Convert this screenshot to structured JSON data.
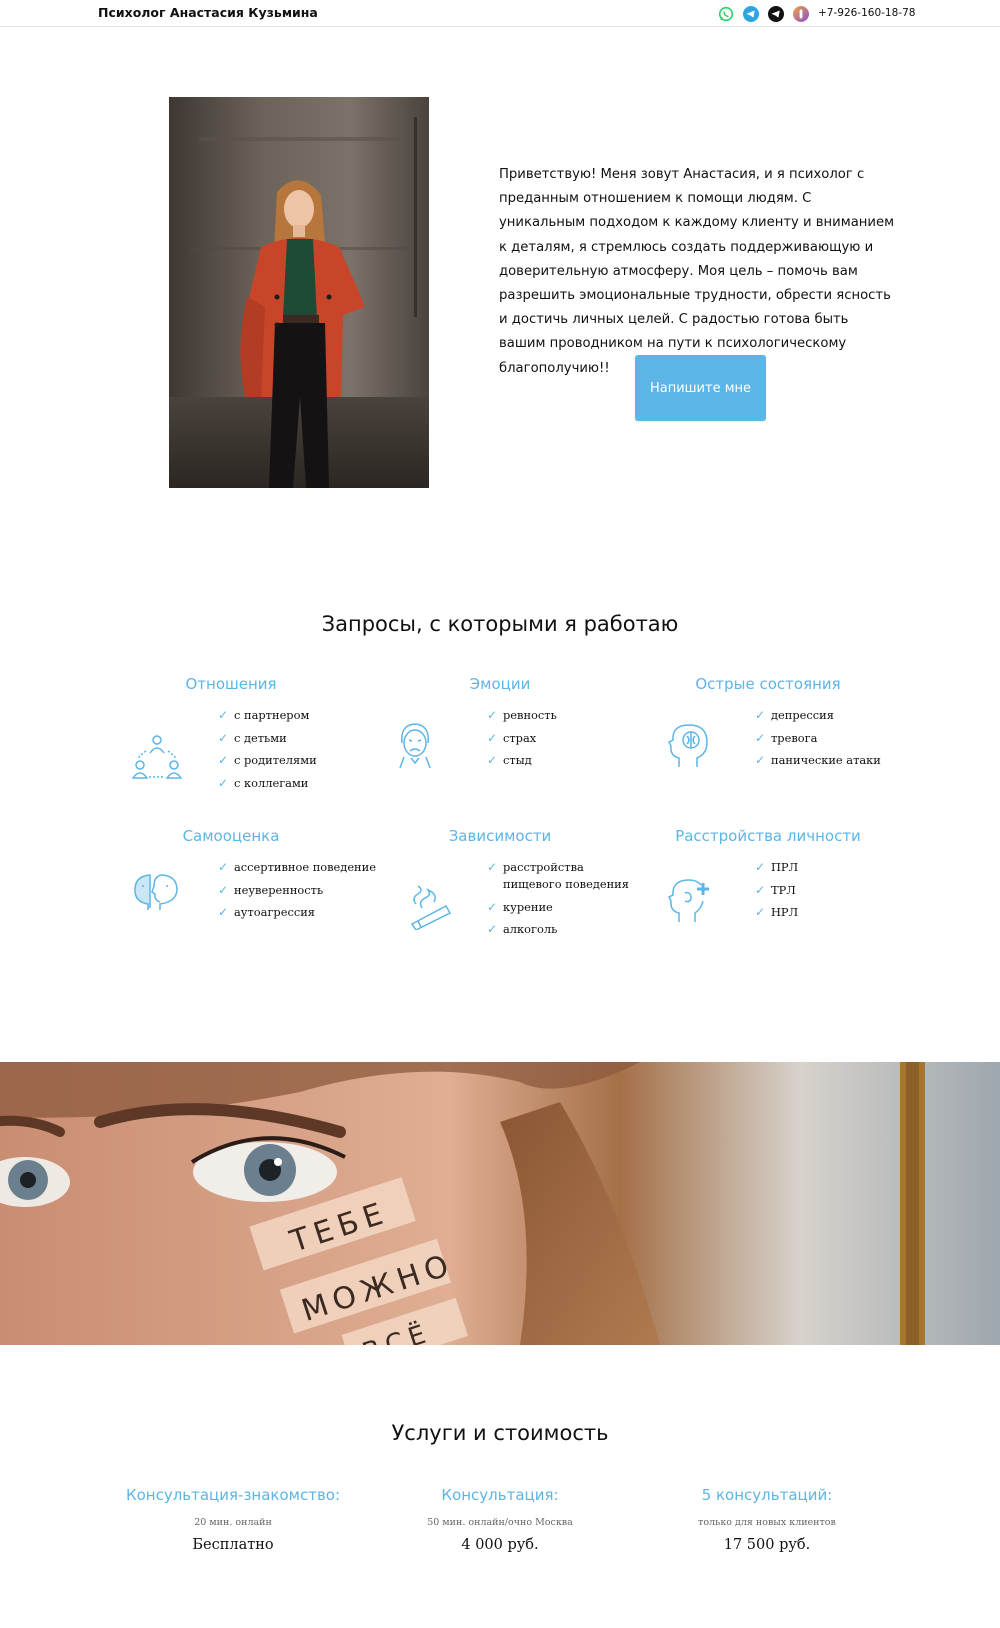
{
  "header": {
    "brand": "Психолог Анастасия Кузьмина",
    "social_icons": [
      "whatsapp-icon",
      "telegram-icon",
      "telegram-dark-icon",
      "viber-icon"
    ],
    "phone": "+7-926-160-18-78"
  },
  "hero": {
    "text": "Приветствую! Меня зовут Анастасия, и я психолог с преданным отношением к помощи людям. С уникальным подходом к каждому клиенту и вниманием к деталям, я стремлюсь создать поддерживающую и доверительную атмосферу. Моя цель – помочь вам разрешить эмоциональные трудности, обрести ясность и достичь личных целей. С радостью готова быть вашим проводником на пути к психологическому благополучию!!",
    "cta_label": "Напишите мне"
  },
  "requests": {
    "title": "Запросы, с которыми я работаю",
    "items": [
      {
        "title": "Отношения",
        "icon": "people-circle-icon",
        "points": [
          "с партнером",
          "с детьми",
          "с родителями",
          "с коллегами"
        ]
      },
      {
        "title": "Эмоции",
        "icon": "sad-face-icon",
        "points": [
          "ревность",
          "страх",
          "стыд"
        ]
      },
      {
        "title": "Острые состояния",
        "icon": "head-brain-icon",
        "points": [
          "депрессия",
          "тревога",
          "панические атаки"
        ]
      },
      {
        "title": "Самооценка",
        "icon": "two-heads-icon",
        "points": [
          "ассертивное поведение",
          "неуверенность",
          "аутоагрессия"
        ]
      },
      {
        "title": "Зависимости",
        "icon": "cigarette-icon",
        "points": [
          "расстройства пищевого поведения",
          "курение",
          "алкоголь"
        ]
      },
      {
        "title": "Расстройства личности",
        "icon": "head-plus-icon",
        "points": [
          "ПРЛ",
          "ТРЛ",
          "НРЛ"
        ]
      }
    ]
  },
  "banner": {
    "words": [
      "ТЕБЕ",
      "МОЖНО",
      "ВСЁ"
    ]
  },
  "services": {
    "title": "Услуги и стоимость",
    "items": [
      {
        "title": "Консультация-знакомство:",
        "note": "20 мин. онлайн",
        "price": "Бесплатно"
      },
      {
        "title": "Консультация:",
        "note": "50 мин. онлайн/очно Москва",
        "price": "4 000 руб."
      },
      {
        "title": "5 консультаций:",
        "note": "только для новых клиентов",
        "price": "17 500 руб."
      }
    ]
  },
  "colors": {
    "accent": "#5cb5e7",
    "text": "#111111"
  }
}
